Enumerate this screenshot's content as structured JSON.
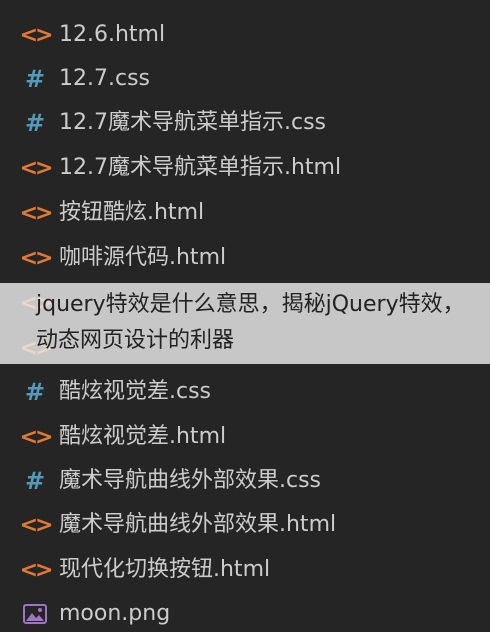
{
  "files": [
    {
      "name": "12.6.html",
      "type": "html",
      "icon": "html-brackets-icon"
    },
    {
      "name": "12.7.css",
      "type": "css",
      "icon": "css-hash-icon"
    },
    {
      "name": "12.7魔术导航菜单指示.css",
      "type": "css",
      "icon": "css-hash-icon"
    },
    {
      "name": "12.7魔术导航菜单指示.html",
      "type": "html",
      "icon": "html-brackets-icon"
    },
    {
      "name": "按钮酷炫.html",
      "type": "html",
      "icon": "html-brackets-icon"
    },
    {
      "name": "咖啡源代码.html",
      "type": "html",
      "icon": "html-brackets-icon"
    },
    {
      "name": "",
      "type": "html",
      "icon": "html-brackets-icon"
    },
    {
      "name": "",
      "type": "html",
      "icon": "html-brackets-icon"
    },
    {
      "name": "酷炫视觉差.css",
      "type": "css",
      "icon": "css-hash-icon"
    },
    {
      "name": "酷炫视觉差.html",
      "type": "html",
      "icon": "html-brackets-icon"
    },
    {
      "name": "魔术导航曲线外部效果.css",
      "type": "css",
      "icon": "css-hash-icon"
    },
    {
      "name": "魔术导航曲线外部效果.html",
      "type": "html",
      "icon": "html-brackets-icon"
    },
    {
      "name": "现代化切换按钮.html",
      "type": "html",
      "icon": "html-brackets-icon"
    },
    {
      "name": "moon.png",
      "type": "png",
      "icon": "image-file-icon"
    }
  ],
  "overlay": {
    "text": "jquery特效是什么意思，揭秘jQuery特效，动态网页设计的利器"
  },
  "colors": {
    "background": "#252526",
    "text": "#cccccc",
    "html_icon": "#e37933",
    "css_icon": "#519aba",
    "png_icon": "#a074c4"
  }
}
